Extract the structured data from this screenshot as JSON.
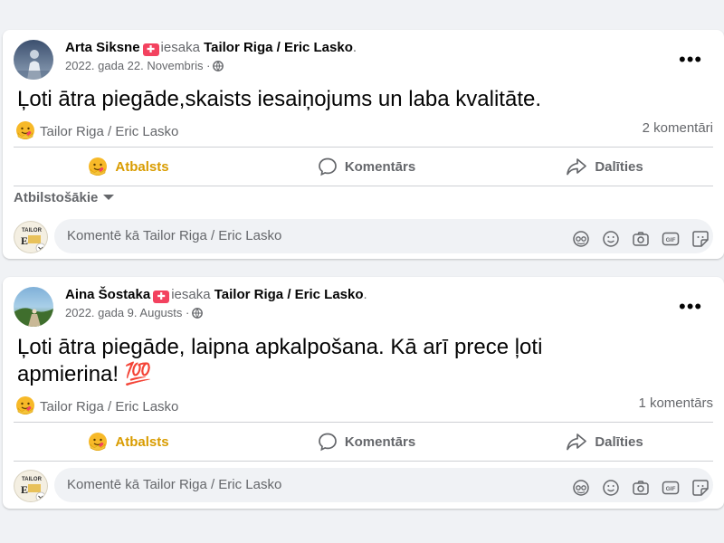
{
  "posts": [
    {
      "author": "Arta Siksne",
      "verb": "iesaka",
      "page": "Tailor Riga / Eric Lasko",
      "date": "2022. gada 22. Novembris",
      "text_line1": "Ļoti ātra piegāde,skaists iesaiņojums un laba kvalitāte.",
      "text_line2": "",
      "reaction_name": "Tailor Riga / Eric Lasko",
      "comment_count": "2 komentāri",
      "filter_label": "Atbilstošākie",
      "comment_placeholder": "Komentē kā Tailor Riga / Eric Lasko"
    },
    {
      "author": "Aina Šostaka",
      "verb": "iesaka",
      "page": "Tailor Riga / Eric Lasko",
      "date": "2022. gada 9. Augusts",
      "text_line1": "Ļoti ātra piegāde, laipna apkalpošana. Kā arī prece ļoti",
      "text_line2": "apmierina! 💯",
      "reaction_name": "Tailor Riga / Eric Lasko",
      "comment_count": "1 komentārs",
      "comment_placeholder": "Komentē kā Tailor Riga / Eric Lasko"
    }
  ],
  "actions": {
    "support": "Atbalsts",
    "comment": "Komentārs",
    "share": "Dalīties"
  },
  "commenter_avatar_text": "TAILOR",
  "icons": {
    "recommend": "recommend-badge-icon",
    "privacy": "globe-icon",
    "more": "more-options-icon",
    "care": "care-reaction-icon",
    "comment": "comment-bubble-icon",
    "share": "share-arrow-icon",
    "avatar_sticker": "avatar-sticker-icon",
    "emoji": "emoji-icon",
    "camera": "camera-icon",
    "gif": "gif-icon",
    "sticker": "sticker-icon"
  },
  "colors": {
    "support_accent": "#f7b928",
    "recommend_badge": "#f3425f",
    "muted_text": "#65676b"
  }
}
